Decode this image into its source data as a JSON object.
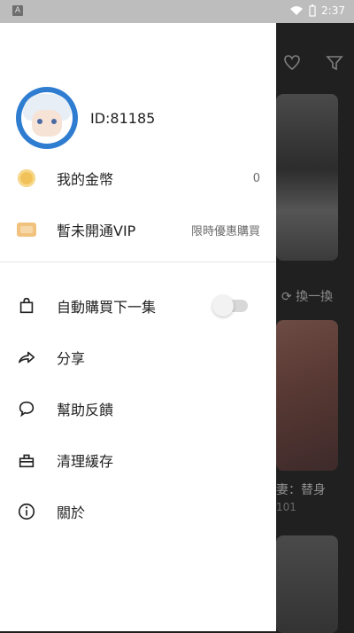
{
  "status_bar": {
    "time": "2:37"
  },
  "background": {
    "swap_label": "換一換",
    "title_snip": "妻：替身",
    "num_snip": "101"
  },
  "drawer": {
    "profile": {
      "user_id": "ID:81185"
    },
    "coins": {
      "label": "我的金幣",
      "value": "0"
    },
    "vip": {
      "label": "暫未開通VIP",
      "right_text": "限時優惠購買"
    },
    "menu": [
      {
        "label": "自動購買下一集",
        "icon": "shopping-bag-icon"
      },
      {
        "label": "分享",
        "icon": "share-icon"
      },
      {
        "label": "幫助反饋",
        "icon": "chat-bubble-icon"
      },
      {
        "label": "清理緩存",
        "icon": "basket-icon"
      },
      {
        "label": "關於",
        "icon": "info-icon"
      }
    ],
    "auto_buy_toggle": {
      "state": "off"
    }
  }
}
